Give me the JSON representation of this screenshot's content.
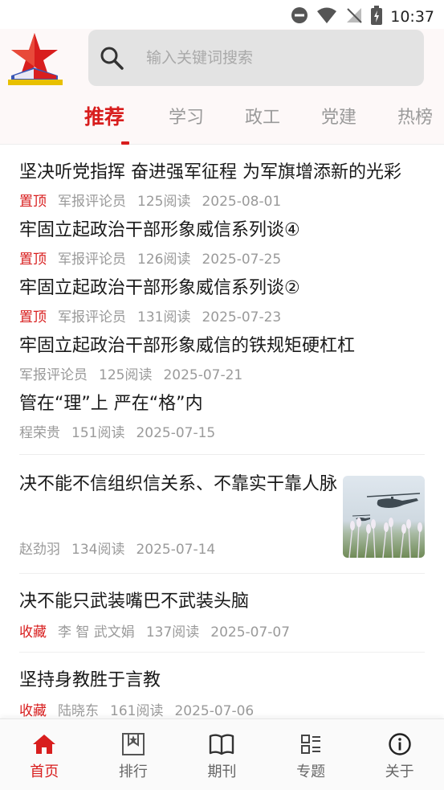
{
  "status_bar": {
    "time": "10:37"
  },
  "search": {
    "placeholder": "输入关键词搜索"
  },
  "tabs": [
    {
      "label": "推荐",
      "active": true
    },
    {
      "label": "学习"
    },
    {
      "label": "政工"
    },
    {
      "label": "党建"
    },
    {
      "label": "热榜"
    }
  ],
  "pinned": [
    {
      "title": "坚决听党指挥 奋进强军征程 为军旗增添新的光彩",
      "tag": "置顶",
      "author": "军报评论员",
      "reads": "125阅读",
      "date": "2025-08-01"
    },
    {
      "title": "牢固立起政治干部形象威信系列谈④",
      "tag": "置顶",
      "author": "军报评论员",
      "reads": "126阅读",
      "date": "2025-07-25"
    },
    {
      "title": "牢固立起政治干部形象威信系列谈②",
      "tag": "置顶",
      "author": "军报评论员",
      "reads": "131阅读",
      "date": "2025-07-23"
    },
    {
      "title": "牢固立起政治干部形象威信的铁规矩硬杠杠",
      "tag": "",
      "author": "军报评论员",
      "reads": "125阅读",
      "date": "2025-07-21"
    },
    {
      "title": "管在“理”上 严在“格”内",
      "tag": "",
      "author": "程荣贵",
      "reads": "151阅读",
      "date": "2025-07-15"
    }
  ],
  "articles": [
    {
      "title": "决不能不信组织信关系、不靠实干靠人脉",
      "tag": "",
      "author": "赵劲羽",
      "reads": "134阅读",
      "date": "2025-07-14",
      "thumb_icon": "helicopter-photo"
    },
    {
      "title": "决不能只武装嘴巴不武装头脑",
      "tag": "收藏",
      "author": "李 智 武文娟",
      "reads": "137阅读",
      "date": "2025-07-07"
    },
    {
      "title": "坚持身教胜于言教",
      "tag": "收藏",
      "author": "陆晓东",
      "reads": "161阅读",
      "date": "2025-07-06"
    }
  ],
  "bottom_nav": [
    {
      "label": "首页",
      "icon": "home-icon",
      "active": true
    },
    {
      "label": "排行",
      "icon": "ranking-icon"
    },
    {
      "label": "期刊",
      "icon": "book-icon"
    },
    {
      "label": "专题",
      "icon": "topics-icon"
    },
    {
      "label": "关于",
      "icon": "info-icon"
    }
  ],
  "colors": {
    "accent": "#d81e1e",
    "muted": "#9a9a9a",
    "search_bg": "#e3e3e3"
  }
}
